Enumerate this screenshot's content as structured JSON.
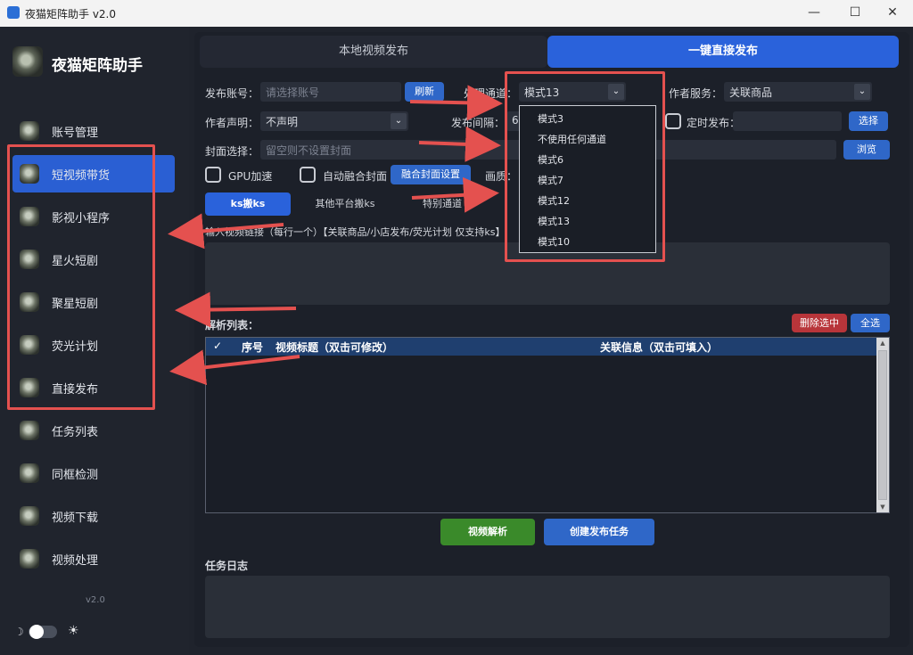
{
  "window": {
    "title": "夜猫矩阵助手 v2.0",
    "minimize": "—",
    "maximize": "☐",
    "close": "✕"
  },
  "sidebar": {
    "brand": "夜猫矩阵助手",
    "items": [
      {
        "label": "账号管理",
        "active": false
      },
      {
        "label": "短视频带货",
        "active": true
      },
      {
        "label": "影视小程序",
        "active": false
      },
      {
        "label": "星火短剧",
        "active": false
      },
      {
        "label": "聚星短剧",
        "active": false
      },
      {
        "label": "荧光计划",
        "active": false
      },
      {
        "label": "直接发布",
        "active": false
      },
      {
        "label": "任务列表",
        "active": false
      },
      {
        "label": "同框检测",
        "active": false
      },
      {
        "label": "视频下载",
        "active": false
      },
      {
        "label": "视频处理",
        "active": false
      }
    ],
    "version": "v2.0",
    "theme": {
      "moon": "☽",
      "sun": "☀"
    }
  },
  "tabs": {
    "local": "本地视频发布",
    "direct": "一键直接发布"
  },
  "form": {
    "account_label": "发布账号：",
    "account_placeholder": "请选择账号",
    "refresh": "刷新",
    "channel_label": "处理通道：",
    "channel_value": "模式13",
    "service_label": "作者服务：",
    "service_value": "关联商品",
    "statement_label": "作者声明：",
    "statement_value": "不声明",
    "interval_label": "发布间隔：",
    "interval_value": "60",
    "timed_label": "定时发布：",
    "select": "选择",
    "cover_label": "封面选择：",
    "cover_placeholder": "留空则不设置封面",
    "browse": "浏览",
    "gpu_label": "GPU加速",
    "auto_cover_label": "自动融合封面",
    "cover_settings": "融合封面设置",
    "quality_label": "画质："
  },
  "subtabs": [
    "ks搬ks",
    "其他平台搬ks",
    "特别通道"
  ],
  "input_hint": "输入视频链接（每行一个）【关联商品/小店发布/荧光计划 仅支持ks】",
  "parse_list": {
    "title": "解析列表：",
    "delete_selected": "删除选中",
    "select_all": "全选",
    "columns": {
      "check": "✓",
      "index": "序号",
      "video_title": "视频标题（双击可修改）",
      "related": "关联信息（双击可填入）"
    }
  },
  "actions": {
    "parse": "视频解析",
    "create_task": "创建发布任务"
  },
  "log_title": "任务日志",
  "dropdown_options": [
    "模式3",
    "不使用任何通道",
    "模式6",
    "模式7",
    "模式12",
    "模式13",
    "模式10"
  ],
  "colors": {
    "accent": "#2a62db",
    "annotation": "#e4514f",
    "parse_button": "#3a8a2a",
    "delete_button": "#b8353a"
  }
}
